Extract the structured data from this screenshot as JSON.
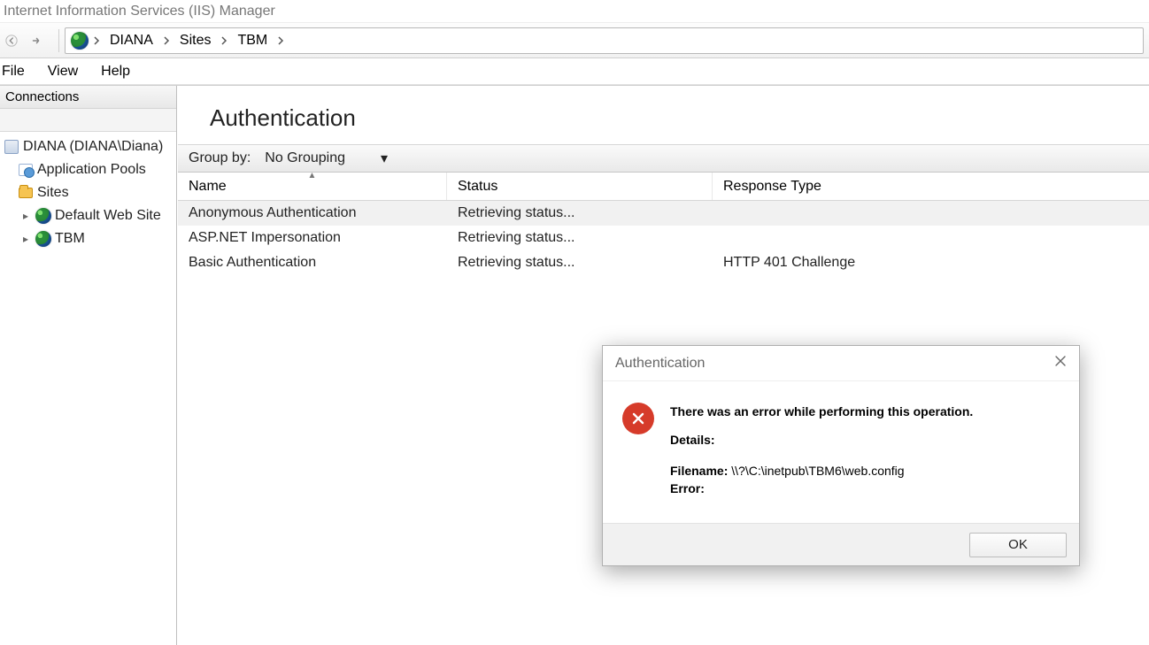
{
  "window": {
    "title": "Internet Information Services (IIS) Manager"
  },
  "menu": {
    "file": "File",
    "view": "View",
    "help": "Help"
  },
  "breadcrumb": {
    "items": [
      "DIANA",
      "Sites",
      "TBM"
    ]
  },
  "connections": {
    "header": "Connections",
    "server": "DIANA (DIANA\\Diana)",
    "pools": "Application Pools",
    "sites": "Sites",
    "site_default": "Default Web Site",
    "site_tbm": "TBM"
  },
  "feature": {
    "title": "Authentication",
    "group_by_label": "Group by:",
    "group_by_value": "No Grouping",
    "columns": {
      "name": "Name",
      "status": "Status",
      "response": "Response Type"
    },
    "rows": [
      {
        "name": "Anonymous Authentication",
        "status": "Retrieving status...",
        "response": ""
      },
      {
        "name": "ASP.NET Impersonation",
        "status": "Retrieving status...",
        "response": ""
      },
      {
        "name": "Basic Authentication",
        "status": "Retrieving status...",
        "response": "HTTP 401 Challenge"
      }
    ]
  },
  "dialog": {
    "title": "Authentication",
    "heading": "There was an error while performing this operation.",
    "details_label": "Details:",
    "filename_label": "Filename:",
    "filename_value": "\\\\?\\C:\\inetpub\\TBM6\\web.config",
    "error_label": "Error:",
    "ok": "OK"
  }
}
